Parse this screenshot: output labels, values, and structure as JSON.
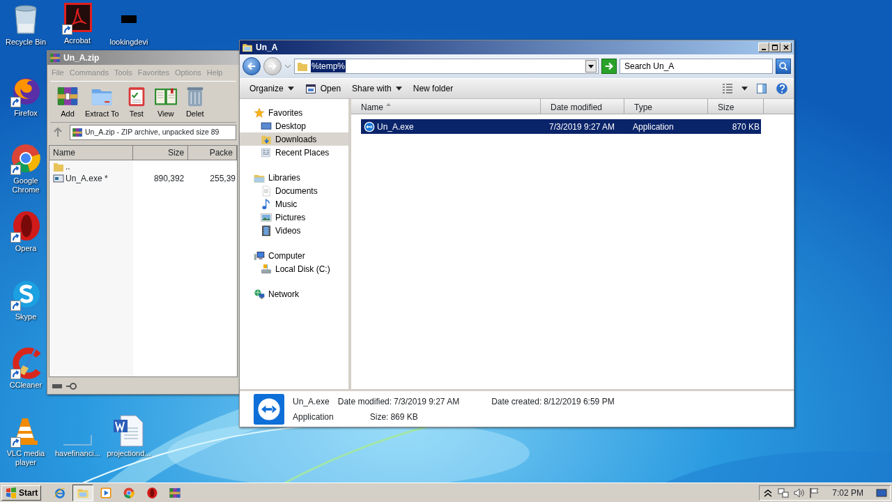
{
  "desktop_icons": [
    {
      "label": "Recycle Bin",
      "kind": "recycle",
      "shortcut": false
    },
    {
      "label": "Acrobat",
      "kind": "acrobat",
      "shortcut": true
    },
    {
      "label": "lookingdevi",
      "kind": "blank",
      "shortcut": false
    },
    {
      "label": "Firefox",
      "kind": "firefox",
      "shortcut": true
    },
    {
      "label": "Google Chrome",
      "kind": "chrome",
      "shortcut": true
    },
    {
      "label": "Opera",
      "kind": "opera",
      "shortcut": true
    },
    {
      "label": "Skype",
      "kind": "skype",
      "shortcut": true
    },
    {
      "label": "CCleaner",
      "kind": "ccleaner",
      "shortcut": true
    },
    {
      "label": "VLC media player",
      "kind": "vlc",
      "shortcut": true
    },
    {
      "label": "havefinanci...",
      "kind": "file",
      "shortcut": false
    },
    {
      "label": "projectiond...",
      "kind": "word",
      "shortcut": false
    }
  ],
  "winrar": {
    "title": "Un_A.zip",
    "menu": [
      "File",
      "Commands",
      "Tools",
      "Favorites",
      "Options",
      "Help"
    ],
    "toolbar": [
      {
        "label": "Add",
        "kind": "archive"
      },
      {
        "label": "Extract To",
        "kind": "folder"
      },
      {
        "label": "Test",
        "kind": "clipboard"
      },
      {
        "label": "View",
        "kind": "book"
      },
      {
        "label": "Delet",
        "kind": "trash"
      }
    ],
    "path": "Un_A.zip - ZIP archive, unpacked size 89",
    "columns": [
      "Name",
      "Size",
      "Packe"
    ],
    "rows": [
      {
        "name": "..",
        "kind": "parent",
        "size": "",
        "packed": ""
      },
      {
        "name": "Un_A.exe *",
        "kind": "exe",
        "size": "890,392",
        "packed": "255,39"
      }
    ]
  },
  "explorer": {
    "title": "Un_A",
    "address": {
      "value": "%temp%",
      "selected": true
    },
    "search": {
      "placeholder": "Search Un_A"
    },
    "toolbar": [
      {
        "label": "Organize",
        "kind": "menu"
      },
      {
        "label": "Open",
        "kind": "open"
      },
      {
        "label": "Share with",
        "kind": "menu"
      },
      {
        "label": "New folder",
        "kind": "plain"
      }
    ],
    "nav": [
      {
        "label": "Favorites",
        "kind": "star",
        "selected": false,
        "children": [
          {
            "label": "Desktop",
            "kind": "desktop",
            "selected": false
          },
          {
            "label": "Downloads",
            "kind": "downloads",
            "selected": true
          },
          {
            "label": "Recent Places",
            "kind": "recent",
            "selected": false
          }
        ]
      },
      {
        "label": "Libraries",
        "kind": "library",
        "selected": false,
        "children": [
          {
            "label": "Documents",
            "kind": "documents",
            "selected": false
          },
          {
            "label": "Music",
            "kind": "music",
            "selected": false
          },
          {
            "label": "Pictures",
            "kind": "pictures",
            "selected": false
          },
          {
            "label": "Videos",
            "kind": "videos",
            "selected": false
          }
        ]
      },
      {
        "label": "Computer",
        "kind": "computer",
        "selected": false,
        "children": [
          {
            "label": "Local Disk (C:)",
            "kind": "disk",
            "selected": false
          }
        ]
      },
      {
        "label": "Network",
        "kind": "network",
        "selected": false
      }
    ],
    "columns": [
      {
        "label": "Name",
        "sorted": true
      },
      {
        "label": "Date modified",
        "sorted": false
      },
      {
        "label": "Type",
        "sorted": false
      },
      {
        "label": "Size",
        "sorted": false
      }
    ],
    "files": [
      {
        "name": "Un_A.exe",
        "date": "7/3/2019 9:27 AM",
        "type": "Application",
        "size": "870 KB",
        "selected": true
      }
    ],
    "details": {
      "name": "Un_A.exe",
      "type": "Application",
      "fields": [
        {
          "label": "Date modified:",
          "value": "7/3/2019 9:27 AM"
        },
        {
          "label": "Date created:",
          "value": "8/12/2019 6:59 PM"
        },
        {
          "label": "Size:",
          "value": "869 KB"
        }
      ]
    }
  },
  "taskbar": {
    "start": "Start",
    "apps": [
      {
        "kind": "ie",
        "selected": false
      },
      {
        "kind": "explorer",
        "selected": true
      },
      {
        "kind": "media",
        "selected": false
      },
      {
        "kind": "chrome",
        "selected": false
      },
      {
        "kind": "opera",
        "selected": false
      },
      {
        "kind": "winrar",
        "selected": false
      }
    ],
    "clock": "7:02 PM"
  }
}
